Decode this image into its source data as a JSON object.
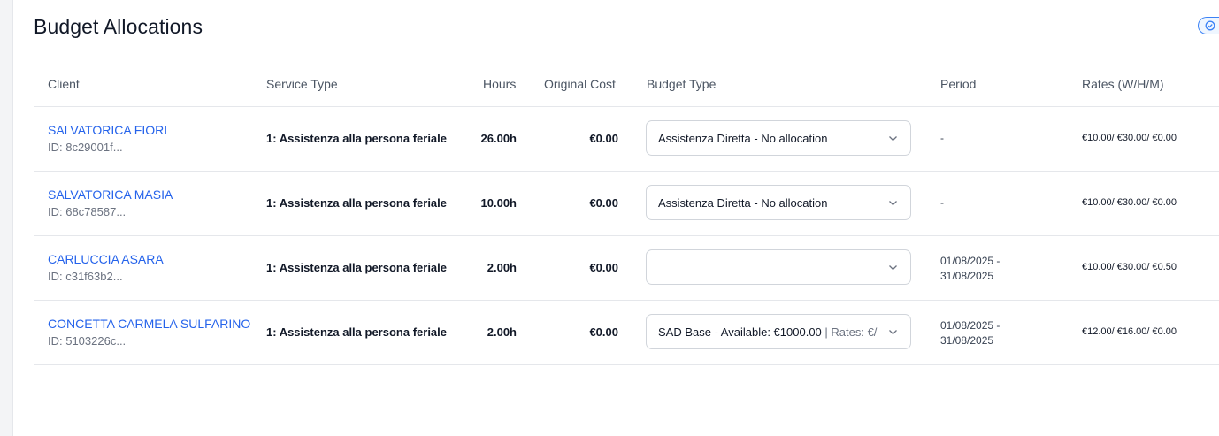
{
  "page": {
    "title": "Budget Allocations"
  },
  "table": {
    "headers": {
      "client": "Client",
      "service_type": "Service Type",
      "hours": "Hours",
      "original_cost": "Original Cost",
      "budget_type": "Budget Type",
      "period": "Period",
      "rates": "Rates (W/H/M)"
    },
    "rows": [
      {
        "client_name": "SALVATORICA FIORI",
        "client_id": "ID: 8c29001f...",
        "service_type": "1: Assistenza alla persona feriale",
        "hours": "26.00h",
        "original_cost": "€0.00",
        "budget_type": "Assistenza Diretta - No allocation",
        "budget_type_extra": "",
        "period_line1": "-",
        "period_line2": "",
        "rates": "€10.00/ €30.00/ €0.00"
      },
      {
        "client_name": "SALVATORICA MASIA",
        "client_id": "ID: 68c78587...",
        "service_type": "1: Assistenza alla persona feriale",
        "hours": "10.00h",
        "original_cost": "€0.00",
        "budget_type": "Assistenza Diretta - No allocation",
        "budget_type_extra": "",
        "period_line1": "-",
        "period_line2": "",
        "rates": "€10.00/ €30.00/ €0.00"
      },
      {
        "client_name": "CARLUCCIA ASARA",
        "client_id": "ID: c31f63b2...",
        "service_type": "1: Assistenza alla persona feriale",
        "hours": "2.00h",
        "original_cost": "€0.00",
        "budget_type": "",
        "budget_type_extra": "",
        "period_line1": "01/08/2025 -",
        "period_line2": "31/08/2025",
        "rates": "€10.00/ €30.00/ €0.50"
      },
      {
        "client_name": "CONCETTA CARMELA SULFARINO",
        "client_id": "ID: 5103226c...",
        "service_type": "1: Assistenza alla persona feriale",
        "hours": "2.00h",
        "original_cost": "€0.00",
        "budget_type": "SAD Base - Available: €1000.00",
        "budget_type_extra": " | Rates: €/",
        "period_line1": "01/08/2025 -",
        "period_line2": "31/08/2025",
        "rates": "€12.00/ €16.00/ €0.00"
      }
    ]
  },
  "colors": {
    "link": "#2563eb",
    "muted": "#6b7280",
    "border": "#e5e7eb",
    "accent": "#3b82f6"
  },
  "icons": {
    "select_chevron": "chevron-down-icon",
    "corner": "check-circle-icon"
  }
}
